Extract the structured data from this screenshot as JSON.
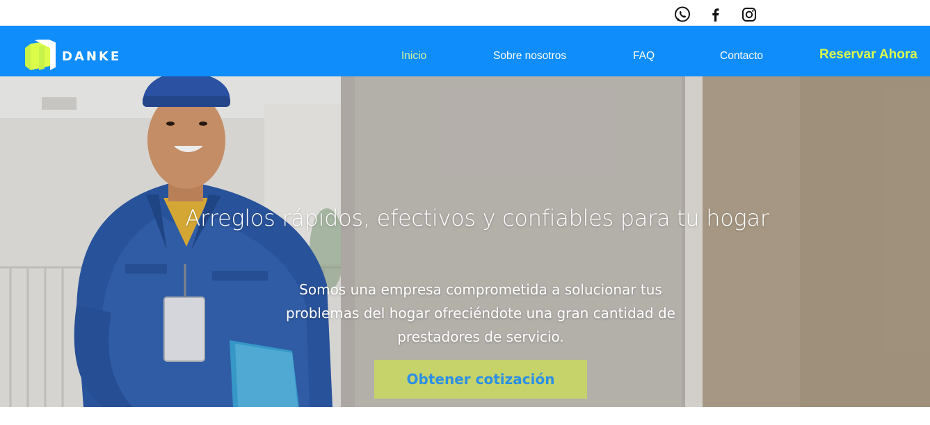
{
  "social": {
    "items": [
      {
        "icon": "whatsapp-icon",
        "label": "WhatsApp"
      },
      {
        "icon": "facebook-icon",
        "label": "Facebook"
      },
      {
        "icon": "instagram-icon",
        "label": "Instagram"
      }
    ]
  },
  "header": {
    "logo_text": "DANKE",
    "nav": [
      {
        "label": "Inicio",
        "active": true
      },
      {
        "label": "Sobre nosotros",
        "active": false
      },
      {
        "label": "FAQ",
        "active": false
      },
      {
        "label": "Contacto",
        "active": false
      }
    ],
    "cta_label": "Reservar Ahora"
  },
  "hero": {
    "title": "Arreglos rápidos, efectivos y confiables para tu hogar",
    "subtitle": "Somos una empresa comprometida a solucionar tus problemas del hogar ofreciéndote una gran cantidad de prestadores de servicio.",
    "cta_label": "Obtener cotización"
  },
  "colors": {
    "header_bg": "#0f8dfa",
    "accent_lime": "#dcfc4a",
    "active_nav": "#d9f99d",
    "cta_bg": "#c5d36a",
    "cta_text": "#2b8fe6"
  }
}
